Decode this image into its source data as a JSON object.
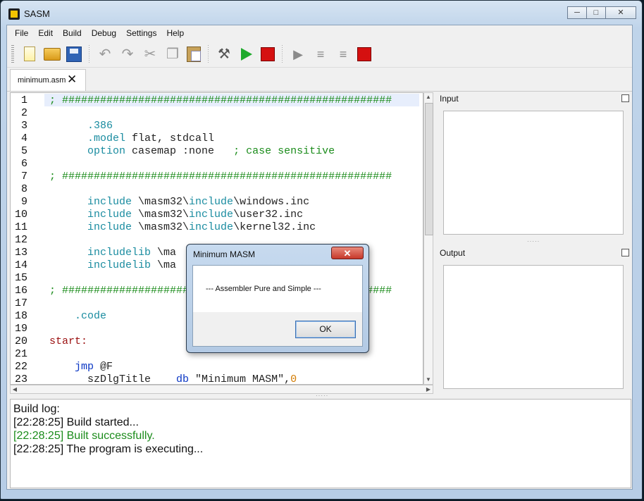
{
  "window": {
    "title": "SASM"
  },
  "caption_buttons": {
    "minimize": "─",
    "maximize": "□",
    "close": "✕"
  },
  "menu": [
    "File",
    "Edit",
    "Build",
    "Debug",
    "Settings",
    "Help"
  ],
  "toolbar": {
    "icons": [
      "new-file-icon",
      "open-folder-icon",
      "save-icon",
      "undo-icon",
      "redo-icon",
      "cut-icon",
      "copy-icon",
      "paste-icon",
      "build-hammer-icon",
      "run-icon",
      "stop-icon",
      "debug-icon",
      "step-over-icon",
      "step-into-icon",
      "debug-stop-icon"
    ]
  },
  "tab": {
    "label": "minimum.asm",
    "close": "✕"
  },
  "editor": {
    "line_numbers": [
      "1",
      "2",
      "3",
      "4",
      "5",
      "6",
      "7",
      "8",
      "9",
      "10",
      "11",
      "12",
      "13",
      "14",
      "15",
      "16",
      "17",
      "18",
      "19",
      "20",
      "21",
      "22",
      "23"
    ],
    "lines": [
      [
        {
          "t": "; ",
          "c": "c"
        },
        {
          "t": "####################################################",
          "c": "c"
        }
      ],
      [],
      [
        {
          "t": "      .386",
          "c": "k"
        }
      ],
      [
        {
          "t": "      .model",
          "c": "k"
        },
        {
          "t": " flat, stdcall",
          "c": "n"
        }
      ],
      [
        {
          "t": "      option",
          "c": "k"
        },
        {
          "t": " casemap :none   ",
          "c": "n"
        },
        {
          "t": "; case sensitive",
          "c": "c"
        }
      ],
      [],
      [
        {
          "t": "; ",
          "c": "c"
        },
        {
          "t": "####################################################",
          "c": "c"
        }
      ],
      [],
      [
        {
          "t": "      include",
          "c": "k"
        },
        {
          "t": " \\masm32\\",
          "c": "n"
        },
        {
          "t": "include",
          "c": "k"
        },
        {
          "t": "\\windows.inc",
          "c": "n"
        }
      ],
      [
        {
          "t": "      include",
          "c": "k"
        },
        {
          "t": " \\masm32\\",
          "c": "n"
        },
        {
          "t": "include",
          "c": "k"
        },
        {
          "t": "\\user32.inc",
          "c": "n"
        }
      ],
      [
        {
          "t": "      include",
          "c": "k"
        },
        {
          "t": " \\masm32\\",
          "c": "n"
        },
        {
          "t": "include",
          "c": "k"
        },
        {
          "t": "\\kernel32.inc",
          "c": "n"
        }
      ],
      [],
      [
        {
          "t": "      includelib",
          "c": "k"
        },
        {
          "t": " \\ma",
          "c": "n"
        }
      ],
      [
        {
          "t": "      includelib",
          "c": "k"
        },
        {
          "t": " \\ma",
          "c": "n"
        }
      ],
      [],
      [
        {
          "t": "; ",
          "c": "c"
        },
        {
          "t": "####################################################",
          "c": "c"
        }
      ],
      [],
      [
        {
          "t": "    .code",
          "c": "k"
        }
      ],
      [],
      [
        {
          "t": "start:",
          "c": "lbl"
        }
      ],
      [],
      [
        {
          "t": "    jmp",
          "c": "ins"
        },
        {
          "t": " @F",
          "c": "n"
        }
      ],
      [
        {
          "t": "      szDlgTitle    ",
          "c": "n"
        },
        {
          "t": "db",
          "c": "ins"
        },
        {
          "t": " \"Minimum MASM\",",
          "c": "n"
        },
        {
          "t": "0",
          "c": "str"
        }
      ]
    ]
  },
  "panels": {
    "input_title": "Input",
    "output_title": "Output"
  },
  "build_log": {
    "lines": [
      {
        "text": "Build log:",
        "status": "normal"
      },
      {
        "text": "[22:28:25] Build started...",
        "status": "normal"
      },
      {
        "text": "[22:28:25] Built successfully.",
        "status": "ok"
      },
      {
        "text": "[22:28:25] The program is executing...",
        "status": "normal"
      }
    ]
  },
  "dialog": {
    "title": "Minimum MASM",
    "close": "✕",
    "message": "--- Assembler Pure and Simple ---",
    "ok_label": "OK"
  },
  "colors": {
    "comment": "#1b8c1b",
    "keyword": "#1a8ca0",
    "label": "#9b1010",
    "instruction": "#0a36c4",
    "success": "#1b8c1b"
  }
}
